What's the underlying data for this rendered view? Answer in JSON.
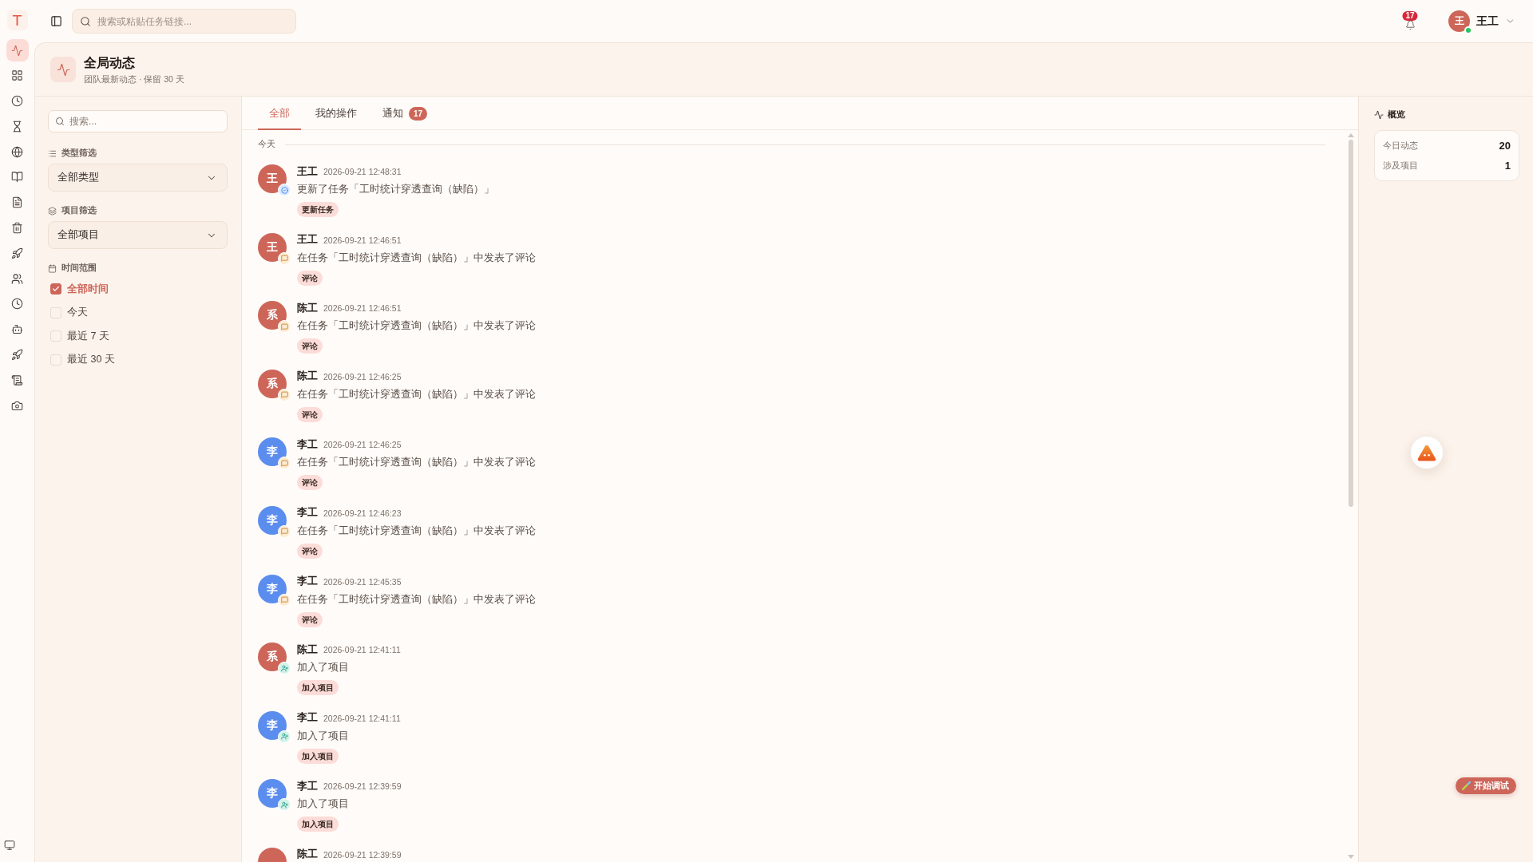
{
  "logo": "T",
  "rail": [
    {
      "selected": true
    },
    {
      "selected": false
    },
    {
      "selected": false
    },
    {
      "selected": false
    },
    {
      "selected": false
    },
    {
      "selected": false
    },
    {
      "selected": false
    },
    {
      "selected": false
    },
    {
      "selected": false
    },
    {
      "selected": false
    },
    {
      "selected": false
    },
    {
      "selected": false
    },
    {
      "selected": false
    },
    {
      "selected": false
    },
    {
      "selected": false
    }
  ],
  "topbar": {
    "search": {
      "placeholder": "搜索或粘贴任务链接..."
    },
    "notifications": {
      "count": "17"
    },
    "user": {
      "avatar_text": "王",
      "name": "王工",
      "online": true
    }
  },
  "header": {
    "title": "全局动态",
    "subtitle": "团队最新动态 · 保留 30 天"
  },
  "filters": {
    "search": {
      "placeholder": "搜索..."
    },
    "type_filter": {
      "label": "类型筛选",
      "value": "全部类型"
    },
    "project_filter": {
      "label": "项目筛选",
      "value": "全部项目"
    },
    "time_range": {
      "label": "时间范围",
      "options": [
        {
          "label": "全部时间",
          "selected": true
        },
        {
          "label": "今天",
          "selected": false
        },
        {
          "label": "最近 7 天",
          "selected": false
        },
        {
          "label": "最近 30 天",
          "selected": false
        }
      ]
    }
  },
  "tabs": [
    {
      "label": "全部",
      "selected": true
    },
    {
      "label": "我的操作",
      "selected": false
    },
    {
      "label": "通知",
      "selected": false,
      "badge": "17"
    }
  ],
  "feed": {
    "section": "今天",
    "items": [
      {
        "avatar_text": "王",
        "color": "#cd6659",
        "name": "王工",
        "time": "2026-09-21 12:48:31",
        "text": "更新了任务「工时统计穿透查询（缺陷）」",
        "kind": "update",
        "tag": "更新任务"
      },
      {
        "avatar_text": "王",
        "color": "#cd6659",
        "name": "王工",
        "time": "2026-09-21 12:46:51",
        "text": "在任务「工时统计穿透查询（缺陷）」中发表了评论",
        "kind": "comment",
        "tag": "评论"
      },
      {
        "avatar_text": "系",
        "color": "#cd6659",
        "name": "陈工",
        "time": "2026-09-21 12:46:51",
        "text": "在任务「工时统计穿透查询（缺陷）」中发表了评论",
        "kind": "comment",
        "tag": "评论"
      },
      {
        "avatar_text": "系",
        "color": "#cd6659",
        "name": "陈工",
        "time": "2026-09-21 12:46:25",
        "text": "在任务「工时统计穿透查询（缺陷）」中发表了评论",
        "kind": "comment",
        "tag": "评论"
      },
      {
        "avatar_text": "李",
        "color": "#5b8def",
        "name": "李工",
        "time": "2026-09-21 12:46:25",
        "text": "在任务「工时统计穿透查询（缺陷）」中发表了评论",
        "kind": "comment",
        "tag": "评论"
      },
      {
        "avatar_text": "李",
        "color": "#5b8def",
        "name": "李工",
        "time": "2026-09-21 12:46:23",
        "text": "在任务「工时统计穿透查询（缺陷）」中发表了评论",
        "kind": "comment",
        "tag": "评论"
      },
      {
        "avatar_text": "李",
        "color": "#5b8def",
        "name": "李工",
        "time": "2026-09-21 12:45:35",
        "text": "在任务「工时统计穿透查询（缺陷）」中发表了评论",
        "kind": "comment",
        "tag": "评论"
      },
      {
        "avatar_text": "系",
        "color": "#cd6659",
        "name": "陈工",
        "time": "2026-09-21 12:41:11",
        "text": "加入了项目",
        "kind": "join",
        "tag": "加入项目"
      },
      {
        "avatar_text": "李",
        "color": "#5b8def",
        "name": "李工",
        "time": "2026-09-21 12:41:11",
        "text": "加入了项目",
        "kind": "join",
        "tag": "加入项目"
      },
      {
        "avatar_text": "李",
        "color": "#5b8def",
        "name": "李工",
        "time": "2026-09-21 12:39:59",
        "text": "加入了项目",
        "kind": "join",
        "tag": "加入项目"
      },
      {
        "color": "#cd6659",
        "name": "陈工",
        "time": "2026-09-21 12:39:59"
      }
    ]
  },
  "overview": {
    "title": "概览",
    "stats": [
      {
        "label": "今日动态",
        "value": "20"
      },
      {
        "label": "涉及项目",
        "value": "1"
      }
    ]
  },
  "debug_button": {
    "label": "开始调试"
  }
}
